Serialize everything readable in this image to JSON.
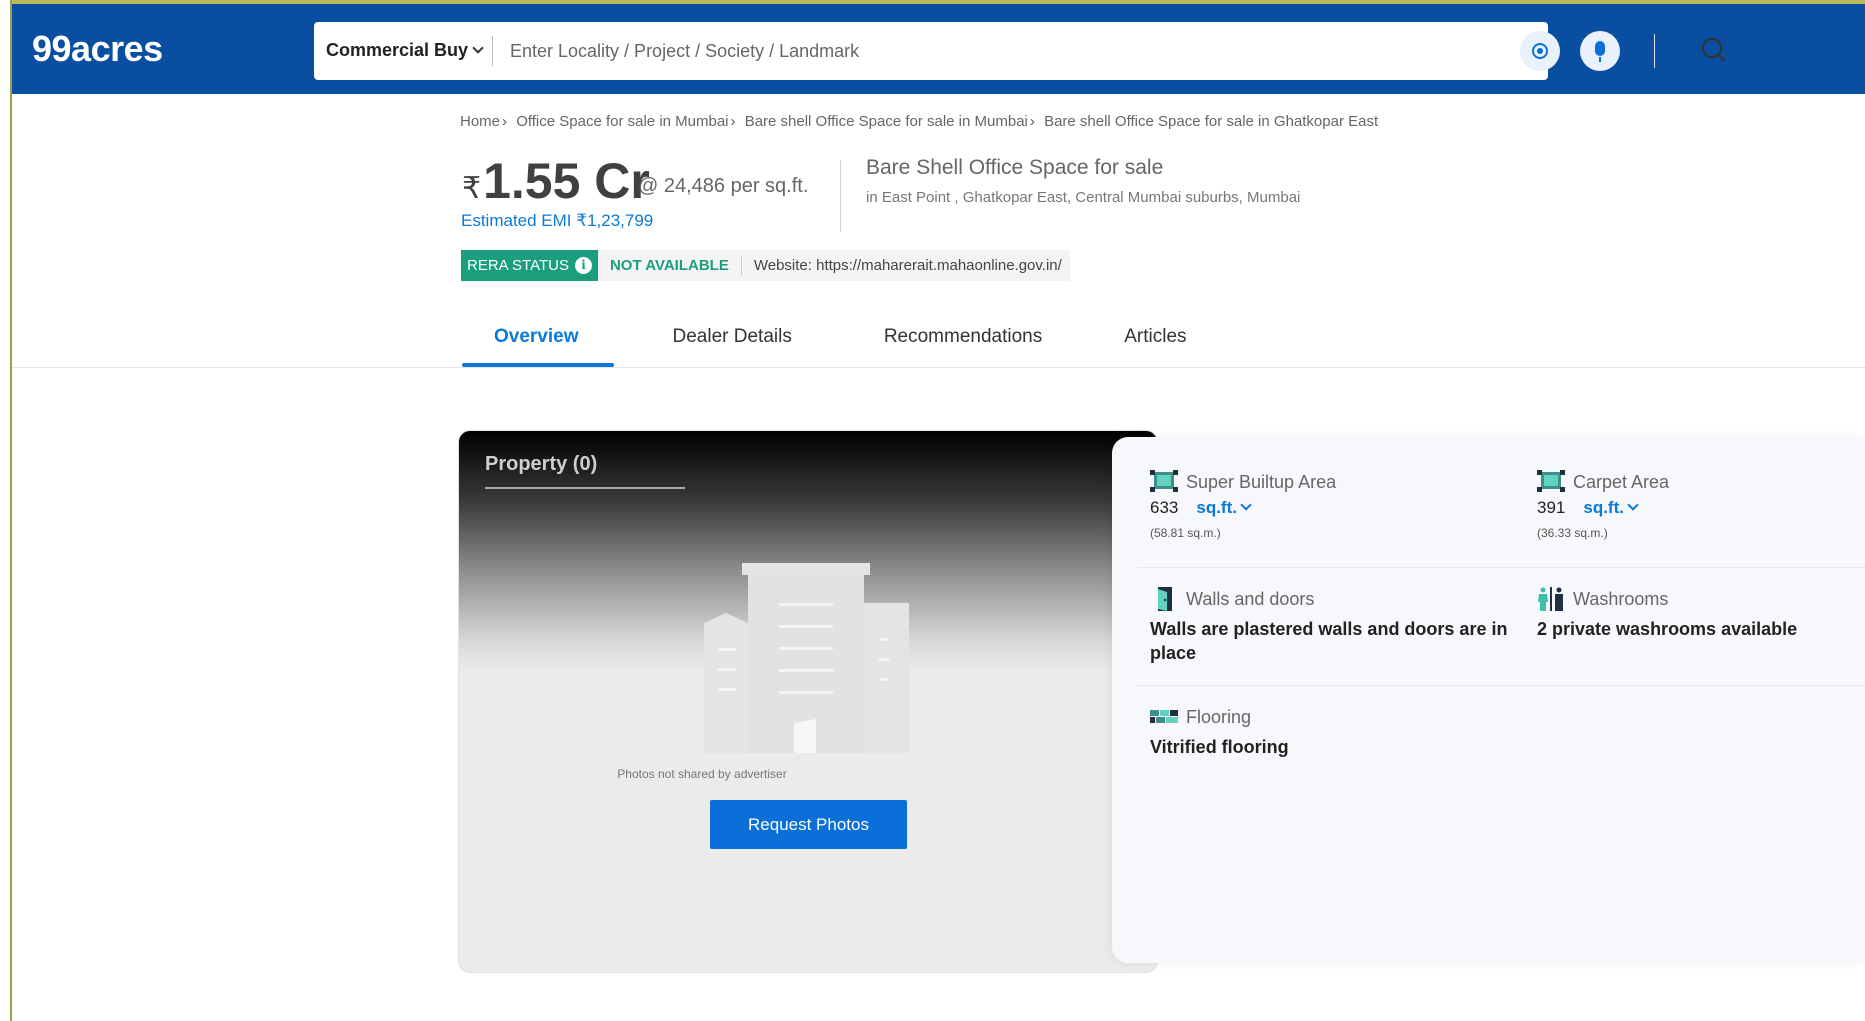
{
  "header": {
    "logo": "99acres",
    "search_type": "Commercial Buy",
    "search_placeholder": "Enter Locality / Project / Society / Landmark",
    "bg_color": "#0a4ea2"
  },
  "breadcrumb": [
    "Home",
    "Office Space for sale in Mumbai",
    "Bare shell Office Space for sale in Mumbai",
    "Bare shell Office Space for sale in Ghatkopar East"
  ],
  "listing": {
    "currency_symbol": "₹",
    "price": "1.55 Cr",
    "rate": "@ 24,486 per sq.ft.",
    "emi": "Estimated EMI ₹1,23,799",
    "title": "Bare Shell Office Space for sale",
    "location": "in East Point , Ghatkopar East, Central Mumbai suburbs, Mumbai"
  },
  "rera": {
    "label": "RERA STATUS",
    "status": "NOT AVAILABLE",
    "website": "Website: https://maharerait.mahaonline.gov.in/",
    "accent_color": "#1a9e7e"
  },
  "tabs": [
    {
      "label": "Overview",
      "active": true
    },
    {
      "label": "Dealer Details",
      "active": false
    },
    {
      "label": "Recommendations",
      "active": false
    },
    {
      "label": "Articles",
      "active": false
    }
  ],
  "photos": {
    "title": "Property (0)",
    "note": "Photos not shared by advertiser",
    "button": "Request Photos"
  },
  "details": {
    "super_builtup": {
      "label": "Super Builtup Area",
      "value": "633",
      "unit": "sq.ft.",
      "sqm": "(58.81 sq.m.)"
    },
    "carpet": {
      "label": "Carpet Area",
      "value": "391",
      "unit": "sq.ft.",
      "sqm": "(36.33 sq.m.)"
    },
    "walls": {
      "label": "Walls and doors",
      "value": "Walls are plastered walls and doors are in place"
    },
    "washrooms": {
      "label": "Washrooms",
      "value": "2 private washrooms available"
    },
    "flooring": {
      "label": "Flooring",
      "value": "Vitrified flooring"
    }
  }
}
